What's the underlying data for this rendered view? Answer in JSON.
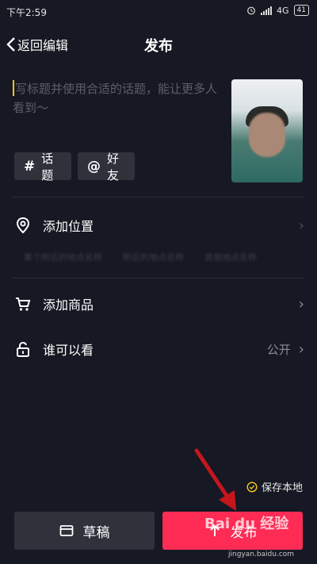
{
  "status_bar": {
    "time": "下午2:59",
    "network": "4G",
    "battery": "41"
  },
  "header": {
    "back_label": "返回编辑",
    "title": "发布"
  },
  "caption": {
    "placeholder": "写标题并使用合适的话题，能让更多人看到～"
  },
  "chips": [
    {
      "symbol": "#",
      "label": "话题"
    },
    {
      "symbol": "@",
      "label": "好友"
    }
  ],
  "location": {
    "label": "添加位置",
    "suggestions": [
      "某个附近的地点名称",
      "附近的地点名称",
      "其他地点名称"
    ]
  },
  "product": {
    "label": "添加商品"
  },
  "visibility": {
    "label": "谁可以看",
    "value": "公开"
  },
  "save_local": {
    "label": "保存本地"
  },
  "buttons": {
    "draft": "草稿",
    "publish": "发布"
  },
  "watermark": {
    "brand": "Bai du 经验",
    "site": "jingyan.baidu.com"
  },
  "colors": {
    "background": "#161823",
    "accent": "#fe2c55",
    "cursor": "#f8c820",
    "chip_bg": "#2f313b"
  }
}
